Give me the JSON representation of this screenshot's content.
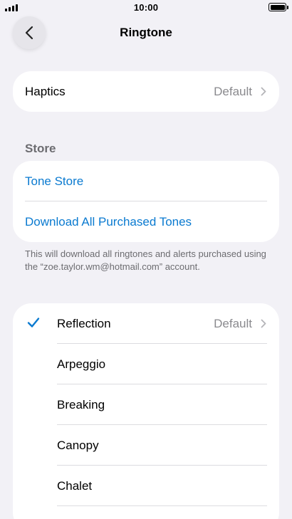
{
  "status_bar": {
    "time": "10:00",
    "icons": [
      "cellular-signal-icon",
      "battery-icon"
    ]
  },
  "nav": {
    "title": "Ringtone",
    "back_icon": "chevron-left-icon"
  },
  "haptics": {
    "label": "Haptics",
    "value": "Default"
  },
  "store": {
    "header": "Store",
    "items": [
      {
        "label": "Tone Store"
      },
      {
        "label": "Download All Purchased Tones"
      }
    ],
    "footnote": "This will download all ringtones and alerts purchased using the “zoe.taylor.wm@hotmail.com” account."
  },
  "tones": {
    "items": [
      {
        "label": "Reflection",
        "value": "Default",
        "selected": true
      },
      {
        "label": "Arpeggio"
      },
      {
        "label": "Breaking"
      },
      {
        "label": "Canopy"
      },
      {
        "label": "Chalet"
      }
    ]
  },
  "colors": {
    "background": "#f2f1f6",
    "accent": "#0a7ad0",
    "secondary_text": "#8a8a8e"
  }
}
